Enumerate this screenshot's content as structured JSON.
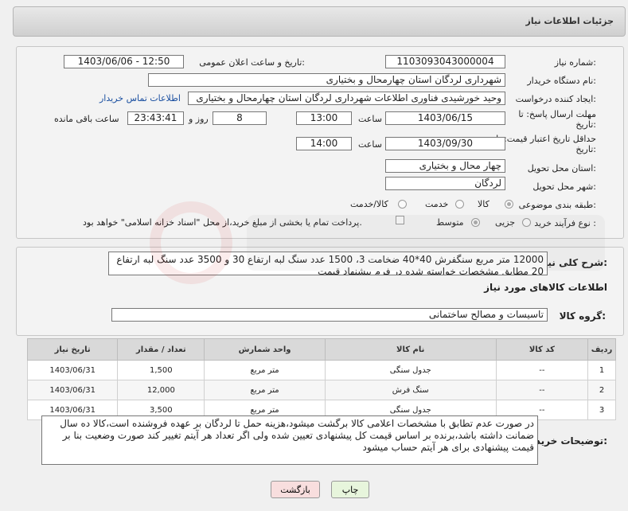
{
  "header": {
    "title": "جزئیات اطلاعات نیاز"
  },
  "form": {
    "need_no_label": "شماره نیاز:",
    "need_no": "1103093043000004",
    "announce_label": "تاریخ و ساعت اعلان عمومی:",
    "announce_value": "1403/06/06 - 12:50",
    "buyer_label": "نام دستگاه خریدار:",
    "buyer": "شهرداری لردگان استان چهارمحال و بختیاری",
    "creator_label": "ایجاد کننده درخواست:",
    "creator": "وحید خورشیدی فناوری اطلاعات شهرداری لردگان استان چهارمحال و بختیاری",
    "contact_link": "اطلاعات تماس خریدار",
    "deadline_label_1": "مهلت ارسال پاسخ: تا",
    "deadline_label_2": "تاریخ:",
    "deadline_date": "1403/06/15",
    "time_label": "ساعت",
    "deadline_time": "13:00",
    "days": "8",
    "days_label": "روز و",
    "remaining": "23:43:41",
    "remaining_label": "ساعت باقی مانده",
    "validity_label_1": "حداقل تاریخ اعتبار قیمت: تا",
    "validity_label_2": "تاریخ:",
    "validity_date": "1403/09/30",
    "validity_time": "14:00",
    "province_label": "استان محل تحویل:",
    "province": "چهار محال و بختیاری",
    "city_label": "شهر محل تحویل:",
    "city": "لردگان",
    "category_label": "طبقه بندی موضوعی:",
    "cat_goods": "کالا",
    "cat_service": "خدمت",
    "cat_both": "کالا/خدمت",
    "process_label": "نوع فرآیند خرید :",
    "proc_minor": "جزیی",
    "proc_medium": "متوسط",
    "payment_note": "پرداخت تمام یا بخشی از مبلغ خرید،از محل \"اسناد خزانه اسلامی\" خواهد بود."
  },
  "description": {
    "label": "شرح کلی نیاز:",
    "text": "12000 متر مربع سنگفرش 40*40 ضخامت 3، 1500 عدد سنگ لبه ارتفاع 30 و 3500 عدد سنگ لبه ارتفاع 20 مطابق مشخصات خواسته شده در فرم پیشنهاد قیمت"
  },
  "goods": {
    "section_title": "اطلاعات کالاهای مورد نیاز",
    "group_label": "گروه کالا:",
    "group_value": "تاسیسات و مصالح ساختمانی",
    "columns": [
      "ردیف",
      "کد کالا",
      "نام کالا",
      "واحد شمارش",
      "تعداد / مقدار",
      "تاریخ نیاز"
    ],
    "rows": [
      {
        "row": "1",
        "code": "--",
        "name": "جدول سنگی",
        "unit": "متر مربع",
        "qty": "1,500",
        "date": "1403/06/31"
      },
      {
        "row": "2",
        "code": "--",
        "name": "سنگ فرش",
        "unit": "متر مربع",
        "qty": "12,000",
        "date": "1403/06/31"
      },
      {
        "row": "3",
        "code": "--",
        "name": "جدول سنگی",
        "unit": "متر مربع",
        "qty": "3,500",
        "date": "1403/06/31"
      }
    ]
  },
  "buyer_notes": {
    "label": "توضیحات خریدار:",
    "text": "در صورت عدم تطابق با مشخصات اعلامی کالا برگشت میشود،هزینه حمل تا لردگان بر عهده فروشنده است،کالا ده سال ضمانت داشته باشد،برنده بر اساس قیمت کل پیشنهادی تعیین شده ولی اگر تعداد هر آیتم تغییر کند صورت وضعیت بنا بر قیمت پیشنهادی برای هر آیتم حساب میشود"
  },
  "buttons": {
    "print": "چاپ",
    "back": "بازگشت"
  },
  "colors": {
    "link": "#1a4fa0",
    "print_btn": "#e7f5dc",
    "back_btn": "#f8dede"
  }
}
